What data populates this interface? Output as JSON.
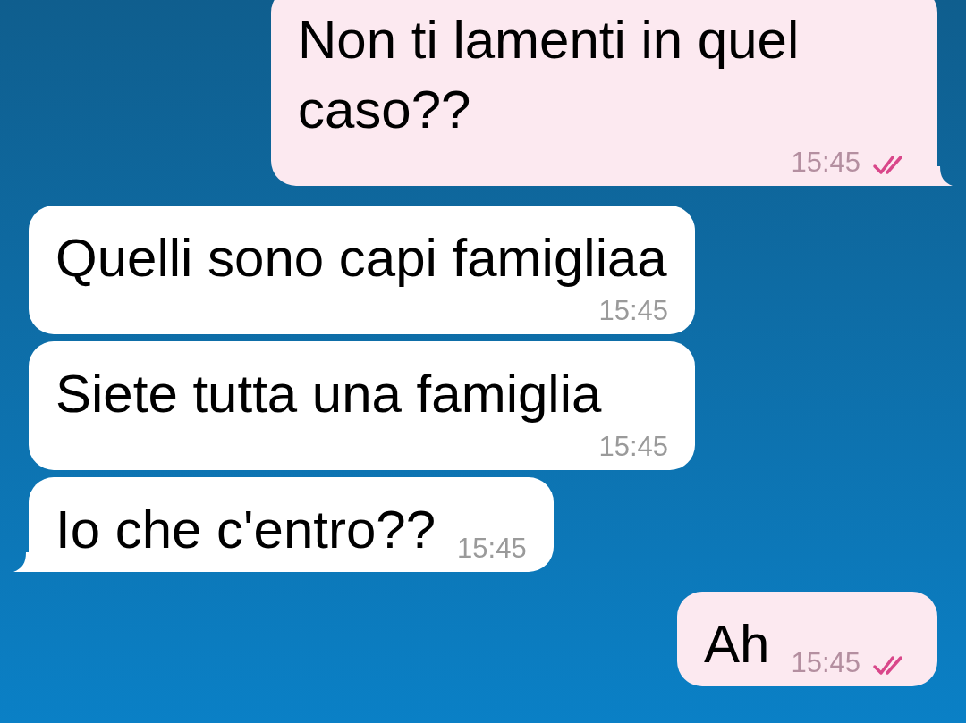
{
  "messages": [
    {
      "kind": "outgoing",
      "text": "Non ti lamenti in quel caso??",
      "time": "15:45",
      "read": true,
      "tail": true
    },
    {
      "kind": "incoming",
      "text": "Quelli sono capi famigliaa",
      "time": "15:45",
      "tail": false
    },
    {
      "kind": "incoming",
      "text": "Siete tutta una famiglia",
      "time": "15:45",
      "tail": false
    },
    {
      "kind": "incoming",
      "text": "Io che c'entro??",
      "time": "15:45",
      "tail": true
    },
    {
      "kind": "outgoing",
      "text": "Ah",
      "time": "15:45",
      "read": true,
      "tail": false
    }
  ]
}
